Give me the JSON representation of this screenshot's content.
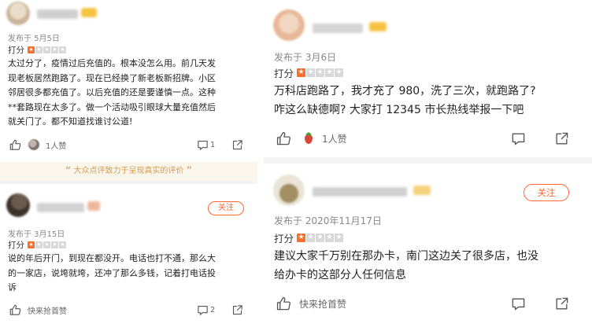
{
  "left": {
    "review1": {
      "published": "发布于 5月5日",
      "rating_label": "打分",
      "stars_filled": 1,
      "stars_total": 5,
      "lines": [
        "太过分了，疫情过后充值的。根本没怎么用。前几天发",
        "现老板居然跑路了。现在已经换了新老板新招牌。小区",
        "邻居很多都充值了。以后充值的还是要谨慎一点。这种",
        "**套路现在太多了。做一个活动吸引眼球大量充值然后",
        "就关门了。都不知道找谁讨公道!"
      ],
      "likes": "1人赞",
      "comments": "1"
    },
    "slogan": "大众点评致力于呈现真实的评价",
    "review2": {
      "follow": "关注",
      "published": "发布于 3月15日",
      "rating_label": "打分",
      "stars_filled": 1,
      "stars_total": 5,
      "lines": [
        "说的年后开门，到现在都没开。电话也打不通，那么大",
        "的一家店，说垮就垮，还冲了那么多钱，记着打电话投",
        "诉"
      ],
      "likes": "快来抢首赞",
      "comments": "2"
    }
  },
  "right": {
    "review1": {
      "published": "发布于 3月6日",
      "rating_label": "打分",
      "stars_filled": 1,
      "stars_total": 5,
      "lines": [
        "万科店跑路了，我才充了 980，洗了三次，就跑路了?",
        "咋这么缺德啊? 大家打 12345 市长热线举报一下吧"
      ],
      "likes": "1人赞"
    },
    "review2": {
      "follow": "关注",
      "published": "发布于 2020年11月17日",
      "rating_label": "打分",
      "stars_filled": 1,
      "stars_total": 5,
      "lines": [
        "建议大家千万别在那办卡，南门这边关了很多店，也没",
        "给办卡的这部分人任何信息"
      ],
      "likes": "快来抢首赞"
    }
  },
  "icons": {
    "like": "thumbs-up-icon",
    "comment": "comment-icon",
    "share": "share-icon",
    "quote": "quote-icon"
  },
  "colors": {
    "accent": "#f96d2d",
    "follow": "#ff6633",
    "slogan_bg": "#fbf6ec",
    "slogan_text": "#d49a52",
    "meta": "#888888"
  }
}
